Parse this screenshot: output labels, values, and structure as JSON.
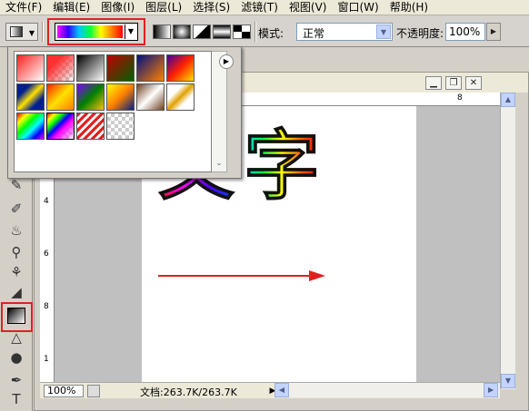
{
  "menu": [
    "文件(F)",
    "编辑(E)",
    "图像(I)",
    "图层(L)",
    "选择(S)",
    "滤镜(T)",
    "视图(V)",
    "窗口(W)",
    "帮助(H)"
  ],
  "options": {
    "mode_label": "模式:",
    "mode_value": "正常",
    "opacity_label": "不透明度:",
    "opacity_value": "100%"
  },
  "document": {
    "zoom": "100%",
    "doc_info": "文档:263.7K/263.7K",
    "text_chars": [
      "文",
      "字"
    ]
  },
  "ruler": {
    "h_label": "8",
    "v_labels": [
      "4",
      "6",
      "8",
      "1"
    ]
  },
  "colors": {
    "highlight": "#e02020",
    "arrow": "#e02020"
  }
}
